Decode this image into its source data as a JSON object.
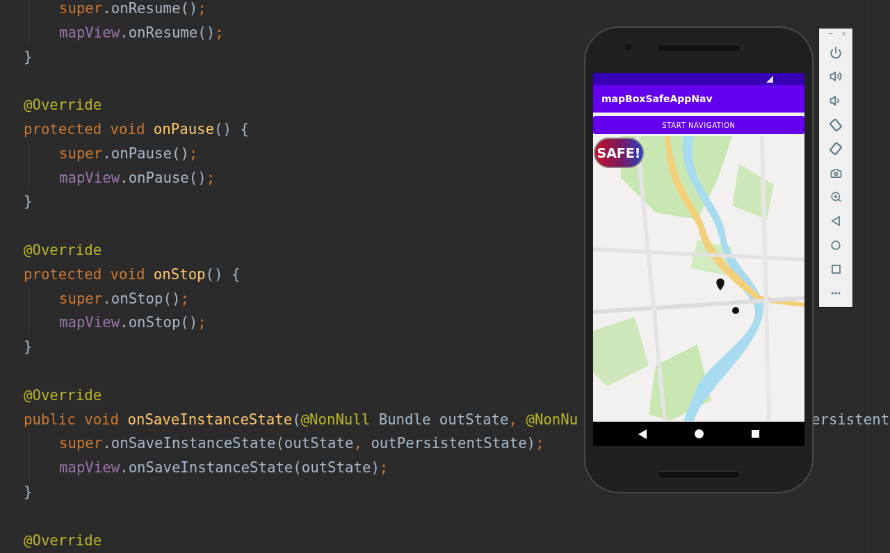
{
  "editor": {
    "blocks": [
      {
        "lines": [
          {
            "indent": true,
            "tokens": [
              {
                "t": "super",
                "kind": "kw"
              },
              {
                "t": ".onResume()",
                "kind": "plain"
              },
              {
                "t": ";",
                "kind": "kw"
              }
            ]
          },
          {
            "indent": true,
            "tokens": [
              {
                "t": "mapView",
                "kind": "field"
              },
              {
                "t": ".onResume()",
                "kind": "plain"
              },
              {
                "t": ";",
                "kind": "kw"
              }
            ]
          },
          {
            "indent": false,
            "tokens": [
              {
                "t": "}",
                "kind": "plain"
              }
            ]
          }
        ]
      },
      {
        "lines": [
          {
            "indent": false,
            "tokens": [
              {
                "t": "@Override",
                "kind": "ann"
              }
            ]
          },
          {
            "indent": false,
            "tokens": [
              {
                "t": "protected void ",
                "kind": "kw"
              },
              {
                "t": "onPause",
                "kind": "method"
              },
              {
                "t": "() {",
                "kind": "plain"
              }
            ]
          },
          {
            "indent": true,
            "tokens": [
              {
                "t": "super",
                "kind": "kw"
              },
              {
                "t": ".onPause()",
                "kind": "plain"
              },
              {
                "t": ";",
                "kind": "kw"
              }
            ]
          },
          {
            "indent": true,
            "tokens": [
              {
                "t": "mapView",
                "kind": "field"
              },
              {
                "t": ".onPause()",
                "kind": "plain"
              },
              {
                "t": ";",
                "kind": "kw"
              }
            ]
          },
          {
            "indent": false,
            "tokens": [
              {
                "t": "}",
                "kind": "plain"
              }
            ]
          }
        ]
      },
      {
        "lines": [
          {
            "indent": false,
            "tokens": [
              {
                "t": "@Override",
                "kind": "ann"
              }
            ]
          },
          {
            "indent": false,
            "tokens": [
              {
                "t": "protected void ",
                "kind": "kw"
              },
              {
                "t": "onStop",
                "kind": "method"
              },
              {
                "t": "() {",
                "kind": "plain"
              }
            ]
          },
          {
            "indent": true,
            "tokens": [
              {
                "t": "super",
                "kind": "kw"
              },
              {
                "t": ".onStop()",
                "kind": "plain"
              },
              {
                "t": ";",
                "kind": "kw"
              }
            ]
          },
          {
            "indent": true,
            "tokens": [
              {
                "t": "mapView",
                "kind": "field"
              },
              {
                "t": ".onStop()",
                "kind": "plain"
              },
              {
                "t": ";",
                "kind": "kw"
              }
            ]
          },
          {
            "indent": false,
            "tokens": [
              {
                "t": "}",
                "kind": "plain"
              }
            ]
          }
        ]
      },
      {
        "lines": [
          {
            "indent": false,
            "tokens": [
              {
                "t": "@Override",
                "kind": "ann"
              }
            ]
          },
          {
            "indent": false,
            "tokens": [
              {
                "t": "public void ",
                "kind": "kw"
              },
              {
                "t": "onSaveInstanceState",
                "kind": "method"
              },
              {
                "t": "(",
                "kind": "plain"
              },
              {
                "t": "@NonNull",
                "kind": "ann"
              },
              {
                "t": " Bundle outState",
                "kind": "plain"
              },
              {
                "t": ", ",
                "kind": "kw"
              },
              {
                "t": "@NonNu",
                "kind": "ann"
              }
            ],
            "tail": "ersistent"
          },
          {
            "indent": true,
            "tokens": [
              {
                "t": "super",
                "kind": "kw"
              },
              {
                "t": ".onSaveInstanceState(outState",
                "kind": "plain"
              },
              {
                "t": ", ",
                "kind": "kw"
              },
              {
                "t": "outPersistentState)",
                "kind": "plain"
              },
              {
                "t": ";",
                "kind": "kw"
              }
            ]
          },
          {
            "indent": true,
            "tokens": [
              {
                "t": "mapView",
                "kind": "field"
              },
              {
                "t": ".onSaveInstanceState(outState)",
                "kind": "plain"
              },
              {
                "t": ";",
                "kind": "kw"
              }
            ]
          },
          {
            "indent": false,
            "tokens": [
              {
                "t": "}",
                "kind": "plain"
              }
            ]
          }
        ]
      },
      {
        "lines": [
          {
            "indent": false,
            "tokens": [
              {
                "t": "@Override",
                "kind": "ann"
              }
            ]
          }
        ]
      }
    ]
  },
  "emulator": {
    "app_title": "mapBoxSafeAppNav",
    "start_button": "START NAVIGATION",
    "safe_button": "SAFE!"
  }
}
